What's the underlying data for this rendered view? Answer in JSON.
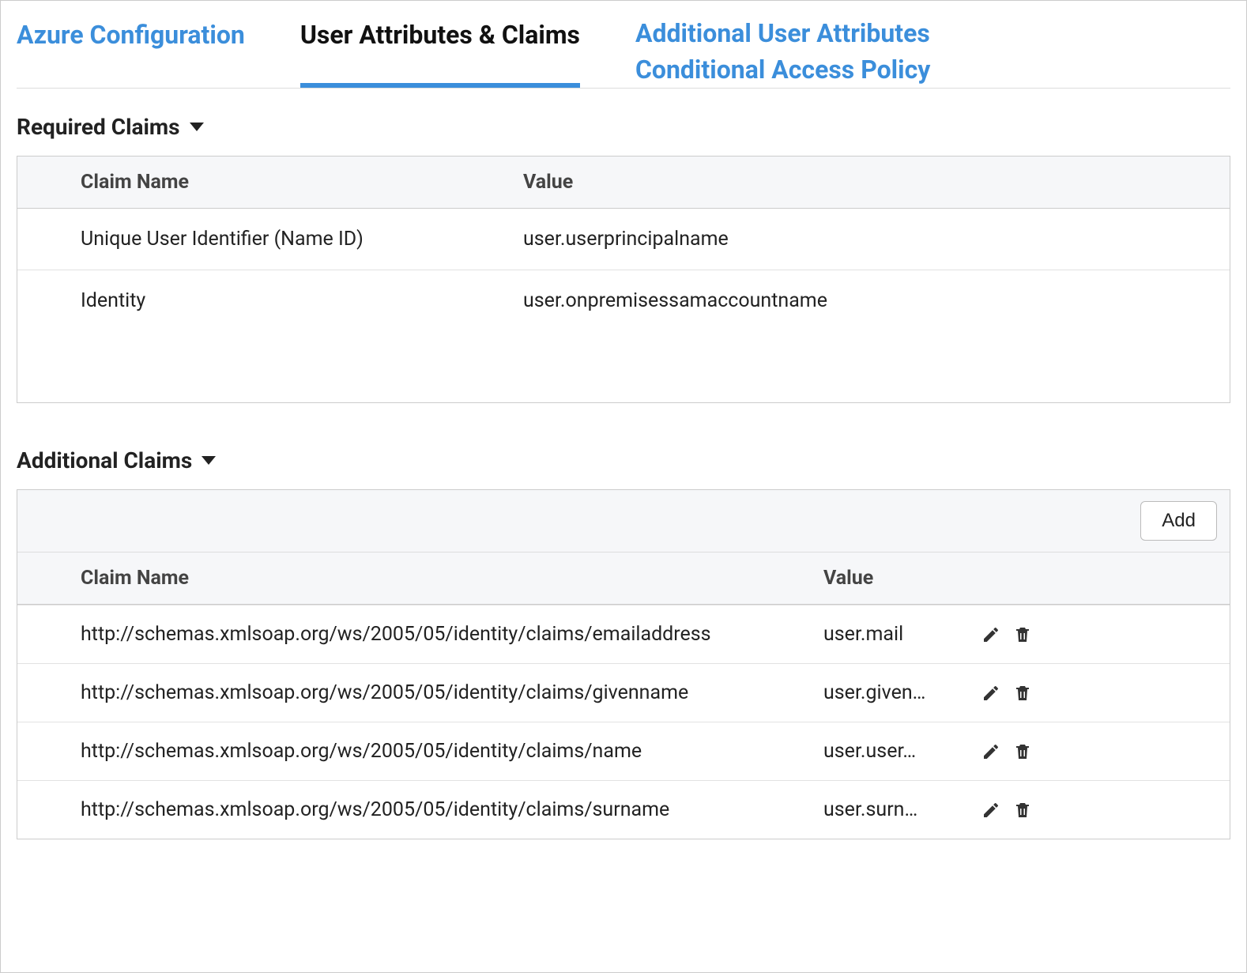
{
  "tabs": {
    "azure": "Azure Configuration",
    "claims": "User Attributes & Claims",
    "additional_attrs": "Additional User Attributes",
    "conditional": "Conditional Access Policy"
  },
  "required": {
    "heading": "Required Claims",
    "cols": {
      "name": "Claim Name",
      "value": "Value"
    },
    "rows": [
      {
        "name": "Unique User Identifier (Name ID)",
        "value": "user.userprincipalname"
      },
      {
        "name": "Identity",
        "value": "user.onpremisessamaccountname"
      }
    ]
  },
  "additional": {
    "heading": "Additional Claims",
    "add_label": "Add",
    "cols": {
      "name": "Claim Name",
      "value": "Value"
    },
    "rows": [
      {
        "name": "http://schemas.xmlsoap.org/ws/2005/05/identity/claims/emailaddress",
        "value": "user.mail"
      },
      {
        "name": "http://schemas.xmlsoap.org/ws/2005/05/identity/claims/givenname",
        "value": "user.given…"
      },
      {
        "name": "http://schemas.xmlsoap.org/ws/2005/05/identity/claims/name",
        "value": "user.user…"
      },
      {
        "name": "http://schemas.xmlsoap.org/ws/2005/05/identity/claims/surname",
        "value": "user.surn…"
      }
    ]
  }
}
